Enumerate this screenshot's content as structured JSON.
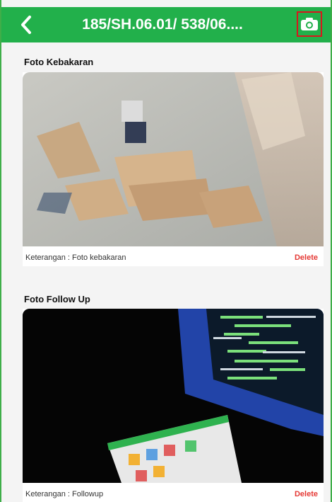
{
  "header": {
    "title": "185/SH.06.01/ 538/06....",
    "back_icon": "chevron-left-icon",
    "camera_icon": "camera-icon",
    "colors": {
      "bar": "#22b04b",
      "highlight": "#d9161c"
    }
  },
  "sections": [
    {
      "title": "Foto Kebakaran",
      "caption": "Keterangan : Foto kebakaran",
      "delete_label": "Delete"
    },
    {
      "title": "Foto Follow Up",
      "caption": "Keterangan : Followup",
      "delete_label": "Delete"
    }
  ]
}
